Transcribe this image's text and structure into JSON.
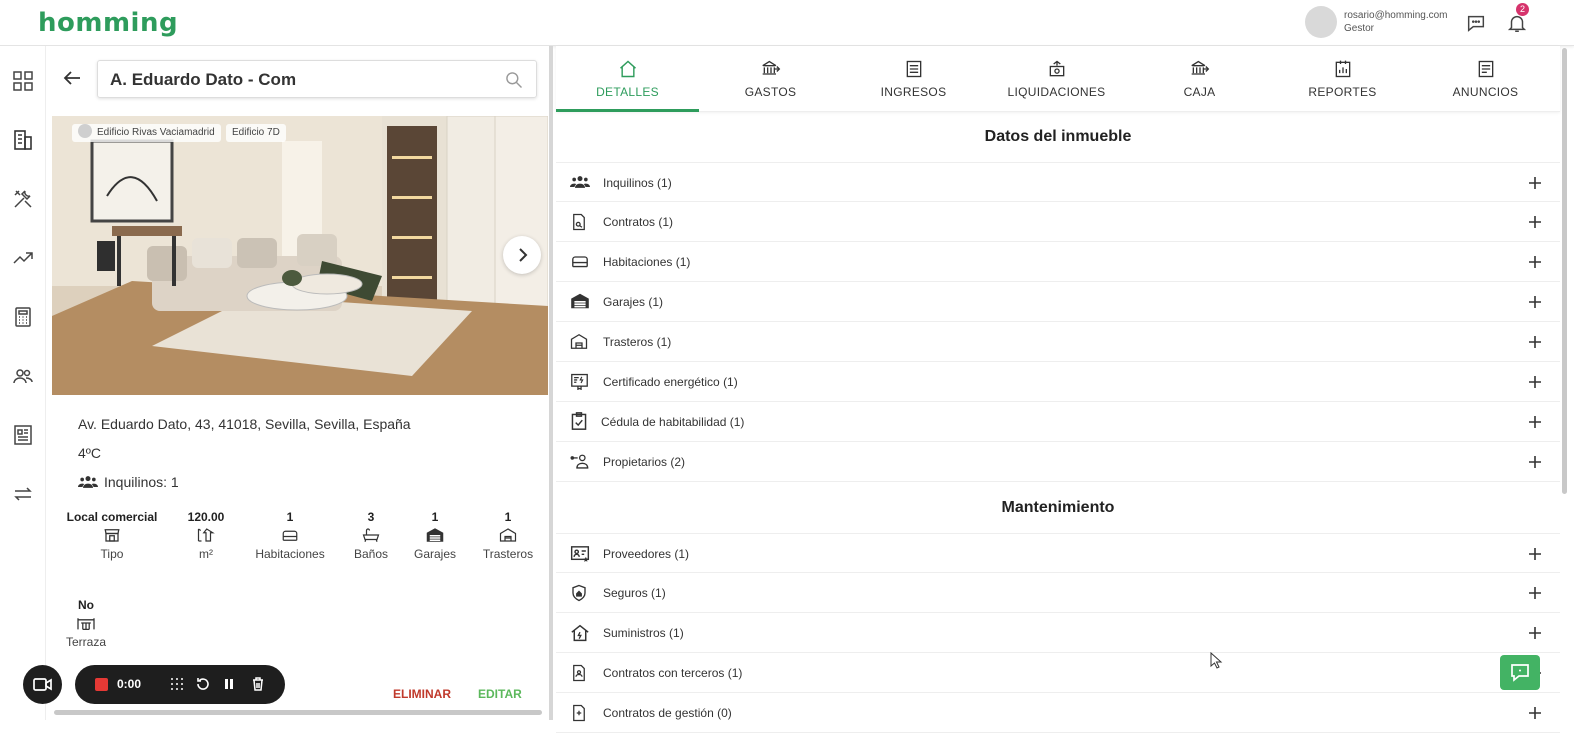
{
  "brand": {
    "name": "homming",
    "accent": "#2e9c5c"
  },
  "user": {
    "email": "rosario@homming.com",
    "role": "Gestor",
    "notifications": "2"
  },
  "sidebar": {
    "items": [
      {
        "icon": "dashboard-icon"
      },
      {
        "icon": "building-icon",
        "active": true
      },
      {
        "icon": "tools-icon"
      },
      {
        "icon": "trending-icon"
      },
      {
        "icon": "calculator-icon"
      },
      {
        "icon": "people-icon"
      },
      {
        "icon": "document-icon"
      },
      {
        "icon": "transfer-icon"
      }
    ]
  },
  "property": {
    "search_value": "A. Eduardo Dato - Com",
    "chips": [
      "Edificio Rivas Vaciamadrid",
      "Edificio 7D"
    ],
    "address": "Av. Eduardo Dato, 43, 41018, Sevilla, Sevilla, España",
    "floor": "4ºC",
    "tenants_label": "Inquilinos: 1",
    "stats": [
      {
        "value": "Local comercial",
        "label": "Tipo"
      },
      {
        "value": "120.00",
        "label": "m²"
      },
      {
        "value": "1",
        "label": "Habitaciones"
      },
      {
        "value": "3",
        "label": "Baños"
      },
      {
        "value": "1",
        "label": "Garajes"
      },
      {
        "value": "1",
        "label": "Trasteros"
      }
    ],
    "terrace": {
      "value": "No",
      "label": "Terraza"
    },
    "delete_label": "ELIMINAR",
    "edit_label": "EDITAR"
  },
  "recorder": {
    "time": "0:00"
  },
  "tabs": [
    "DETALLES",
    "GASTOS",
    "INGRESOS",
    "LIQUIDACIONES",
    "CAJA",
    "REPORTES",
    "ANUNCIOS"
  ],
  "sections": {
    "datos_title": "Datos del inmueble",
    "datos": [
      "Inquilinos (1)",
      "Contratos (1)",
      "Habitaciones (1)",
      "Garajes (1)",
      "Trasteros (1)",
      "Certificado energético (1)",
      "Cédula de habitabilidad (1)",
      "Propietarios (2)"
    ],
    "mantenimiento_title": "Mantenimiento",
    "mantenimiento": [
      "Proveedores (1)",
      "Seguros (1)",
      "Suministros (1)",
      "Contratos con terceros (1)",
      "Contratos de gestión (0)"
    ]
  }
}
